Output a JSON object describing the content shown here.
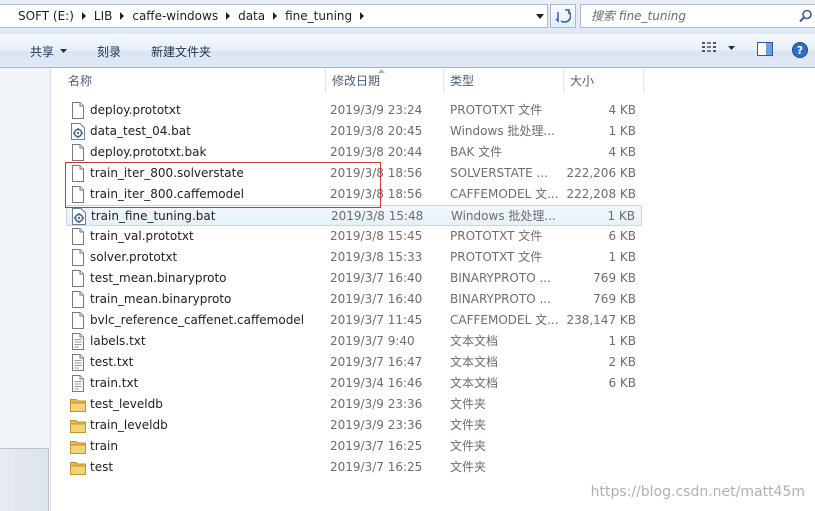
{
  "address_bar": {
    "crumbs": [
      "SOFT (E:)",
      "LIB",
      "caffe-windows",
      "data",
      "fine_tuning"
    ]
  },
  "search": {
    "placeholder": "搜索 fine_tuning"
  },
  "toolbar": {
    "share_label": "共享",
    "burn_label": "刻录",
    "new_folder_label": "新建文件夹"
  },
  "columns": {
    "name": "名称",
    "date": "修改日期",
    "type": "类型",
    "size": "大小"
  },
  "files": [
    {
      "name": "deploy.prototxt",
      "date": "2019/3/9 23:24",
      "type": "PROTOTXT 文件",
      "size": "4 KB",
      "icon": "file"
    },
    {
      "name": "data_test_04.bat",
      "date": "2019/3/8 20:45",
      "type": "Windows 批处理...",
      "size": "1 KB",
      "icon": "batch"
    },
    {
      "name": "deploy.prototxt.bak",
      "date": "2019/3/8 20:44",
      "type": "BAK 文件",
      "size": "4 KB",
      "icon": "file"
    },
    {
      "name": "train_iter_800.solverstate",
      "date": "2019/3/8 18:56",
      "type": "SOLVERSTATE ...",
      "size": "222,206 KB",
      "icon": "file"
    },
    {
      "name": "train_iter_800.caffemodel",
      "date": "2019/3/8 18:56",
      "type": "CAFFEMODEL 文...",
      "size": "222,208 KB",
      "icon": "file"
    },
    {
      "name": "train_fine_tuning.bat",
      "date": "2019/3/8 15:48",
      "type": "Windows 批处理...",
      "size": "1 KB",
      "icon": "batch"
    },
    {
      "name": "train_val.prototxt",
      "date": "2019/3/8 15:45",
      "type": "PROTOTXT 文件",
      "size": "6 KB",
      "icon": "file"
    },
    {
      "name": "solver.prototxt",
      "date": "2019/3/8 15:33",
      "type": "PROTOTXT 文件",
      "size": "1 KB",
      "icon": "file"
    },
    {
      "name": "test_mean.binaryproto",
      "date": "2019/3/7 16:40",
      "type": "BINARYPROTO ...",
      "size": "769 KB",
      "icon": "file"
    },
    {
      "name": "train_mean.binaryproto",
      "date": "2019/3/7 16:40",
      "type": "BINARYPROTO ...",
      "size": "769 KB",
      "icon": "file"
    },
    {
      "name": "bvlc_reference_caffenet.caffemodel",
      "date": "2019/3/7 11:45",
      "type": "CAFFEMODEL 文...",
      "size": "238,147 KB",
      "icon": "file"
    },
    {
      "name": "labels.txt",
      "date": "2019/3/7 9:40",
      "type": "文本文档",
      "size": "1 KB",
      "icon": "text"
    },
    {
      "name": "test.txt",
      "date": "2019/3/7 16:47",
      "type": "文本文档",
      "size": "2 KB",
      "icon": "text"
    },
    {
      "name": "train.txt",
      "date": "2019/3/4 16:46",
      "type": "文本文档",
      "size": "6 KB",
      "icon": "text"
    },
    {
      "name": "test_leveldb",
      "date": "2019/3/9 23:36",
      "type": "文件夹",
      "size": "",
      "icon": "folder"
    },
    {
      "name": "train_leveldb",
      "date": "2019/3/9 23:36",
      "type": "文件夹",
      "size": "",
      "icon": "folder"
    },
    {
      "name": "train",
      "date": "2019/3/7 16:25",
      "type": "文件夹",
      "size": "",
      "icon": "folder"
    },
    {
      "name": "test",
      "date": "2019/3/7 16:25",
      "type": "文件夹",
      "size": "",
      "icon": "folder"
    }
  ],
  "selected_file": "train_fine_tuning.bat",
  "watermark": "https://blog.csdn.net/matt45m",
  "colors": {
    "toolbar_text": "#1e3152",
    "selection_border": "#c7d7ea",
    "annotation_red": "#c8393b",
    "folder_yellow": "#e8b84a"
  }
}
